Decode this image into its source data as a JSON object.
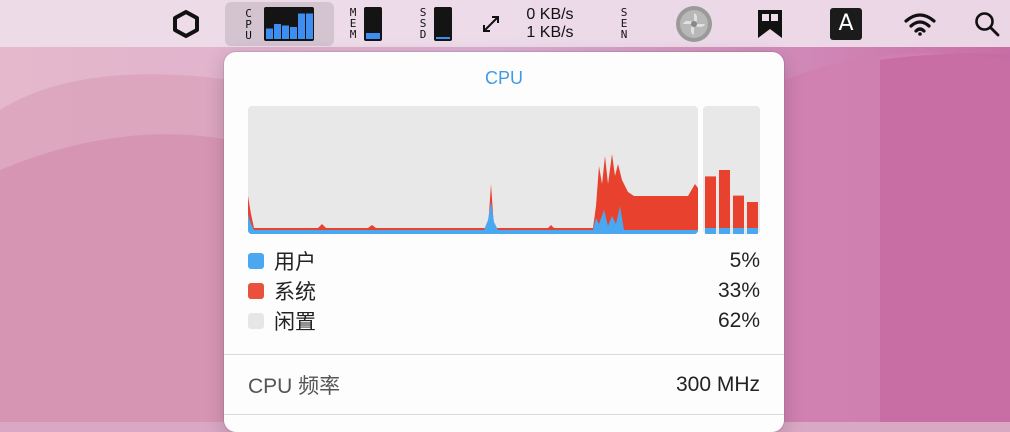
{
  "menubar": {
    "cpu_label": "CPU",
    "mem_label": "MEM",
    "ssd_label": "SSD",
    "sen_label": "SEN",
    "net_up": "0 KB/s",
    "net_down": "1 KB/s",
    "input_badge": "A",
    "cpu_mini_bars": [
      0.35,
      0.5,
      0.45,
      0.4,
      0.85,
      0.85
    ],
    "mem_level": 0.2,
    "ssd_level": 0.06,
    "icons": [
      "hexagon-icon",
      "network-arrows-icon",
      "fan-icon",
      "bookmark-icon",
      "wifi-icon",
      "search-icon"
    ]
  },
  "popup": {
    "title": "CPU",
    "legend": [
      {
        "label": "用户",
        "value": "5%",
        "color": "#4aa8f0"
      },
      {
        "label": "系统",
        "value": "33%",
        "color": "#e8513c"
      },
      {
        "label": "闲置",
        "value": "62%",
        "color": "#e6e6e6"
      }
    ],
    "frequency_label": "CPU 频率",
    "frequency_value": "300 MHz",
    "history_bars": [
      0.45,
      0.5,
      0.3,
      0.25
    ]
  },
  "colors": {
    "user": "#4aa8f0",
    "system": "#e8513c",
    "idle": "#e6e6e6",
    "title": "#3f9be6"
  }
}
